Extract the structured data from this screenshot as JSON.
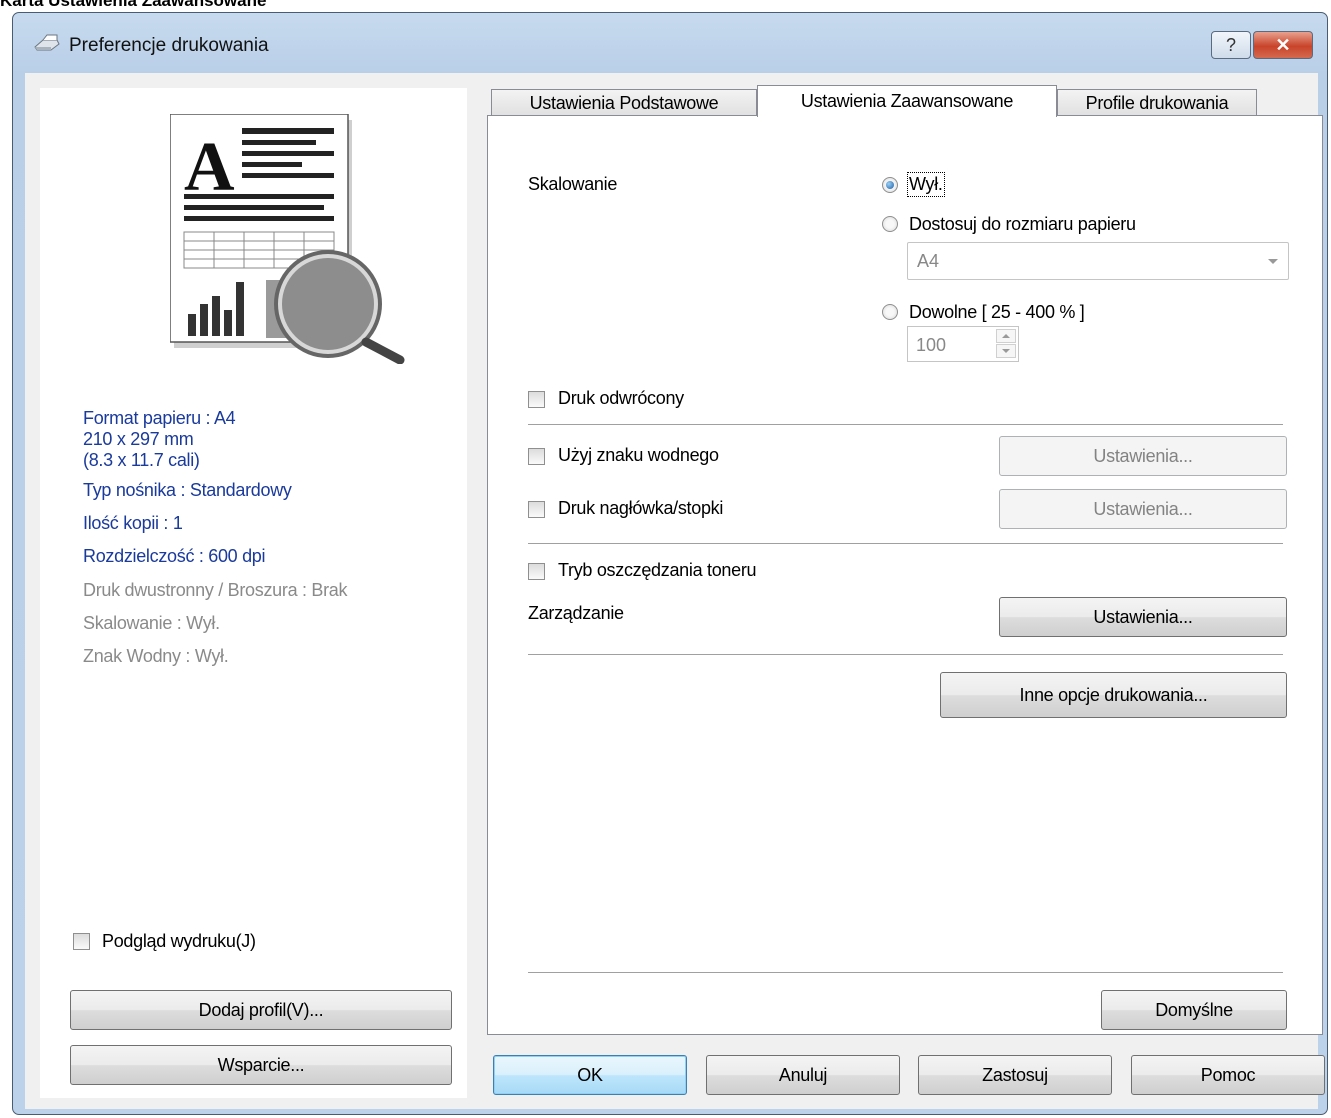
{
  "caption": "Karta Ustawienia Zaawansowane",
  "window": {
    "title": "Preferencje drukowania",
    "help_label": "?",
    "close_label": "✕"
  },
  "left": {
    "info": [
      {
        "text": "Format papieru  : A4",
        "style": "blue"
      },
      {
        "text": "210 x 297 mm",
        "style": "blue"
      },
      {
        "text": "(8.3 x 11.7 cali)",
        "style": "blue"
      },
      {
        "text": "Typ nośnika : Standardowy",
        "style": "blue"
      },
      {
        "text": "Ilość kopii  : 1",
        "style": "blue"
      },
      {
        "text": "Rozdzielczość : 600 dpi",
        "style": "blue"
      },
      {
        "text": "Druk dwustronny / Broszura : Brak",
        "style": "grey"
      },
      {
        "text": "Skalowanie : Wył.",
        "style": "grey"
      },
      {
        "text": "Znak Wodny : Wył.",
        "style": "grey"
      }
    ],
    "preview_checkbox": "Podgląd wydruku(J)",
    "add_profile": "Dodaj profil(V)...",
    "support": "Wsparcie..."
  },
  "tabs": [
    "Ustawienia Podstawowe",
    "Ustawienia Zaawansowane",
    "Profile drukowania"
  ],
  "advanced": {
    "scaling_label": "Skalowanie",
    "radio_off": "Wył.",
    "radio_fit": "Dostosuj do rozmiaru papieru",
    "paper_select": "A4",
    "radio_free": "Dowolne [ 25 - 400 % ]",
    "free_value": "100",
    "reverse": "Druk odwrócony",
    "watermark": "Użyj znaku wodnego",
    "watermark_btn": "Ustawienia...",
    "header_footer": "Druk nagłówka/stopki",
    "header_footer_btn": "Ustawienia...",
    "toner_save": "Tryb oszczędzania toneru",
    "admin": "Zarządzanie",
    "admin_btn": "Ustawienia...",
    "other_options": "Inne opcje drukowania...",
    "default_btn": "Domyślne"
  },
  "footer": {
    "ok": "OK",
    "cancel": "Anuluj",
    "apply": "Zastosuj",
    "help": "Pomoc"
  },
  "colors": {
    "info_blue": "#1a3a9c",
    "info_grey": "#8a8a8a",
    "close_red": "#c8442a"
  }
}
